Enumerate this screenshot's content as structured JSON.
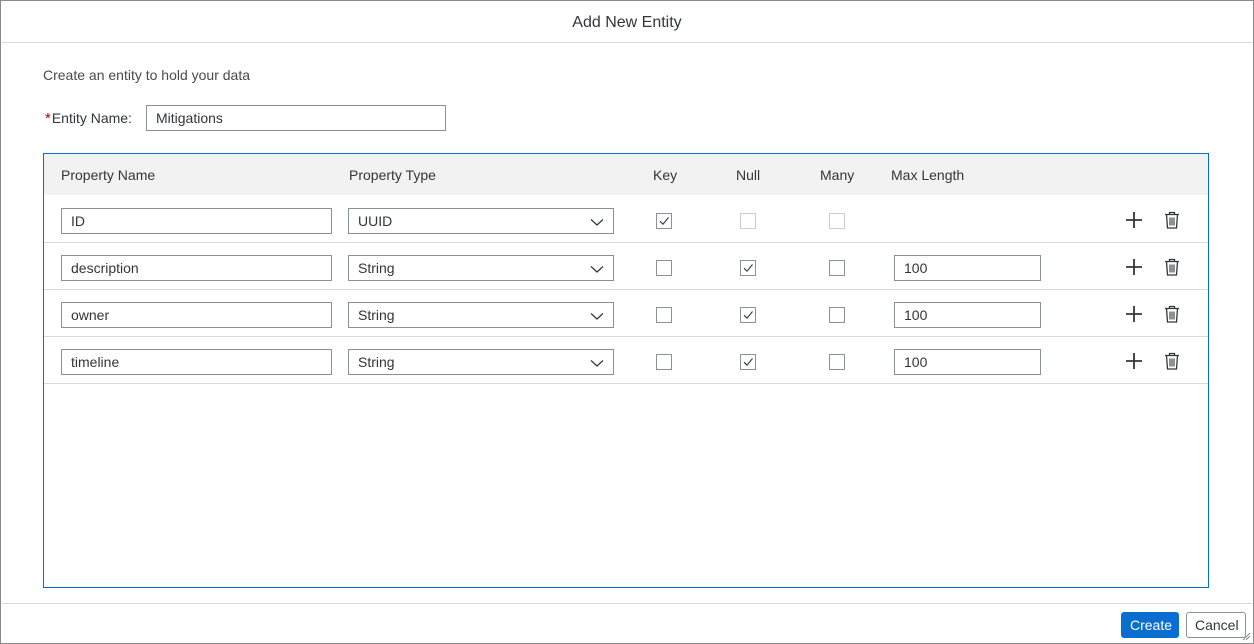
{
  "dialog": {
    "title": "Add New Entity",
    "description": "Create an entity to hold your data",
    "entity_name_required_mark": "*",
    "entity_name_label": "Entity Name:",
    "entity_name_value": "Mitigations"
  },
  "table": {
    "headers": {
      "property_name": "Property Name",
      "property_type": "Property Type",
      "key": "Key",
      "null": "Null",
      "many": "Many",
      "max_length": "Max Length"
    },
    "rows": [
      {
        "name": "ID",
        "type": "UUID",
        "key": true,
        "null": false,
        "many": false,
        "null_disabled": true,
        "many_disabled": true,
        "max_length": ""
      },
      {
        "name": "description",
        "type": "String",
        "key": false,
        "null": true,
        "many": false,
        "max_length": "100"
      },
      {
        "name": "owner",
        "type": "String",
        "key": false,
        "null": true,
        "many": false,
        "max_length": "100"
      },
      {
        "name": "timeline",
        "type": "String",
        "key": false,
        "null": true,
        "many": false,
        "max_length": "100"
      }
    ]
  },
  "footer": {
    "create_label": "Create",
    "cancel_label": "Cancel"
  },
  "colors": {
    "accent": "#0a6ed1",
    "required": "#bb0000",
    "header_bg": "#f2f2f2"
  },
  "icons": [
    "chevron-down-icon",
    "checkmark-icon",
    "add-icon",
    "delete-icon"
  ]
}
